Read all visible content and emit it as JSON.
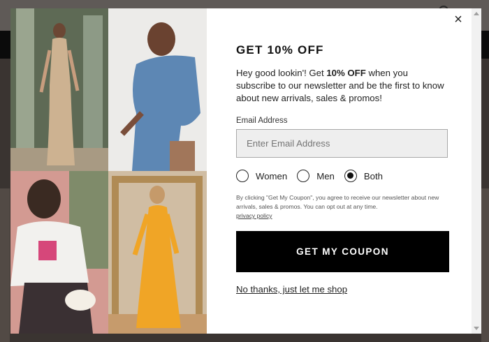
{
  "modal": {
    "close_glyph": "×",
    "title": "GET 10% OFF",
    "description": {
      "prefix": "Hey good lookin'! Get ",
      "highlight": "10% OFF",
      "suffix": " when you subscribe to our newsletter and be the first to know about new arrivals, sales & promos!"
    },
    "email": {
      "label": "Email Address",
      "placeholder": "Enter Email Address",
      "value": ""
    },
    "gender_options": [
      {
        "label": "Women",
        "checked": false
      },
      {
        "label": "Men",
        "checked": false
      },
      {
        "label": "Both",
        "checked": true
      }
    ],
    "legal": {
      "text": "By clicking \"Get My Coupon\", you agree to receive our newsletter about new arrivals, sales & promos. You can opt out at any time.",
      "link": "privacy policy"
    },
    "cta_label": "GET MY COUPON",
    "decline_label": "No thanks, just let me shop"
  },
  "icons": {
    "close": "close-icon",
    "search": "search-icon",
    "scroll_up": "chevron-up-icon",
    "scroll_down": "chevron-down-icon"
  },
  "colors": {
    "overlay": "#2b2725",
    "modal_bg": "#ffffff",
    "cta_bg": "#000000",
    "cta_text": "#ffffff",
    "input_bg": "#eeeeee"
  }
}
